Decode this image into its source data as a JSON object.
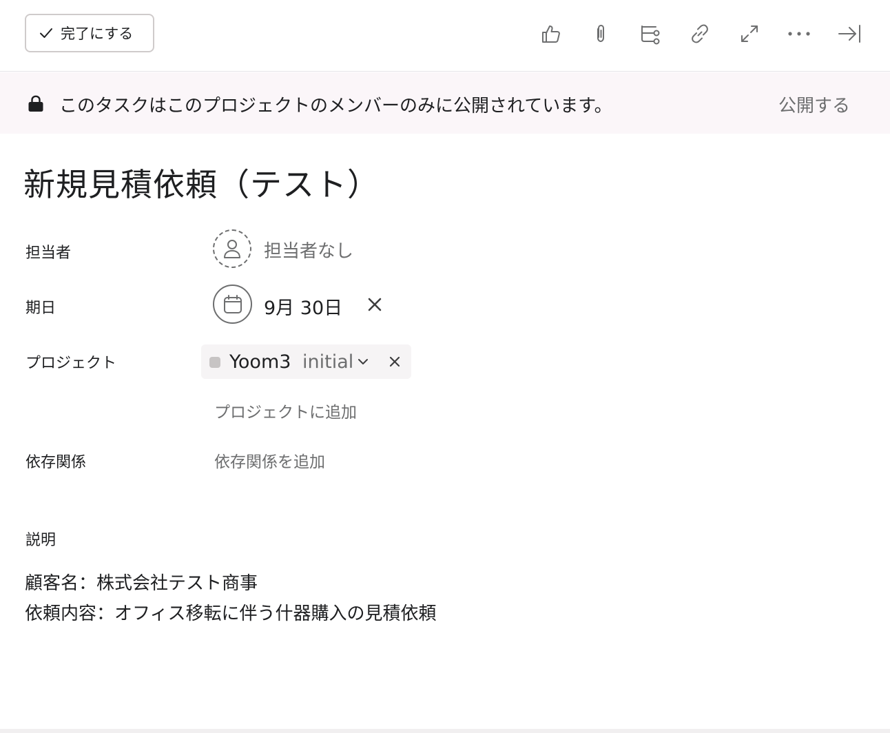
{
  "toolbar": {
    "complete_label": "完了にする",
    "icons": [
      "thumbs-up-icon",
      "paperclip-icon",
      "subtask-icon",
      "link-icon",
      "expand-icon",
      "more-icon",
      "close-pane-icon"
    ]
  },
  "banner": {
    "text": "このタスクはこのプロジェクトのメンバーのみに公開されています。",
    "action": "公開する"
  },
  "task": {
    "title": "新規見積依頼（テスト）"
  },
  "fields": {
    "assignee": {
      "label": "担当者",
      "value": "担当者なし"
    },
    "due_date": {
      "label": "期日",
      "value": "9月 30日"
    },
    "projects": {
      "label": "プロジェクト",
      "items": [
        {
          "name": "Yoom3",
          "section": "initial",
          "color": "#c7c4c4"
        }
      ],
      "add_label": "プロジェクトに追加"
    },
    "dependencies": {
      "label": "依存関係",
      "add_label": "依存関係を追加"
    }
  },
  "description": {
    "label": "説明",
    "lines": [
      "顧客名：株式会社テスト商事",
      "依頼内容：オフィス移転に伴う什器購入の見積依頼"
    ]
  },
  "colors": {
    "banner_bg": "#fbf6f9",
    "text_primary": "#1e1f21",
    "text_secondary": "#6d6e6f",
    "border": "#cfcbcb"
  }
}
